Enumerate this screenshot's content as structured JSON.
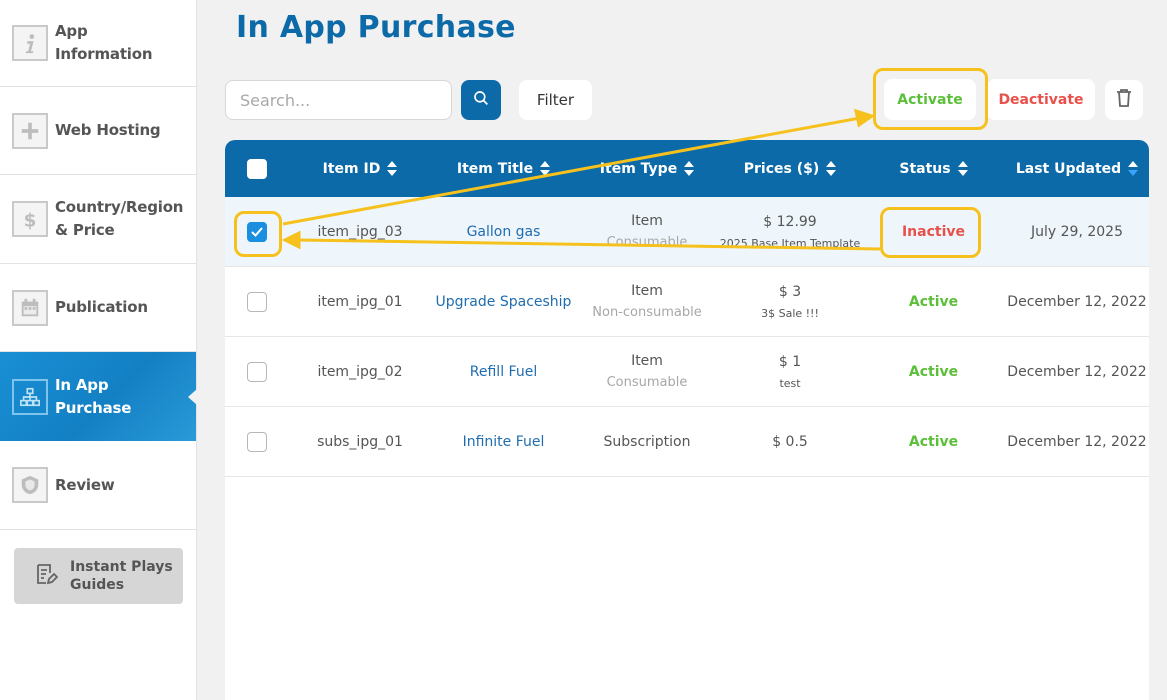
{
  "sidebar": {
    "items": [
      {
        "label": "App\nInformation",
        "icon": "info-icon"
      },
      {
        "label": "Web Hosting",
        "icon": "plus-icon"
      },
      {
        "label": "Country/Region\n& Price",
        "icon": "dollar-icon"
      },
      {
        "label": "Publication",
        "icon": "calendar-icon"
      },
      {
        "label": "In App\nPurchase",
        "icon": "hierarchy-icon",
        "active": true
      },
      {
        "label": "Review",
        "icon": "shield-icon"
      }
    ],
    "guide_label": "Instant Plays\nGuides"
  },
  "page": {
    "title": "In App Purchase"
  },
  "toolbar": {
    "search_placeholder": "Search...",
    "filter_label": "Filter",
    "activate_label": "Activate",
    "deactivate_label": "Deactivate"
  },
  "table": {
    "headers": {
      "item_id": "Item ID",
      "item_title": "Item Title",
      "item_type": "Item Type",
      "prices": "Prices ($)",
      "status": "Status",
      "last_updated": "Last Updated"
    },
    "rows": [
      {
        "checked": true,
        "id": "item_ipg_03",
        "title": "Gallon gas",
        "type": "Item",
        "type_sub": "Consumable",
        "price": "$ 12.99",
        "price_sub": "2025 Base Item Template",
        "status": "Inactive",
        "updated": "July 29, 2025"
      },
      {
        "checked": false,
        "id": "item_ipg_01",
        "title": "Upgrade Spaceship",
        "type": "Item",
        "type_sub": "Non-consumable",
        "price": "$ 3",
        "price_sub": "3$ Sale !!!",
        "status": "Active",
        "updated": "December 12, 2022"
      },
      {
        "checked": false,
        "id": "item_ipg_02",
        "title": "Refill Fuel",
        "type": "Item",
        "type_sub": "Consumable",
        "price": "$ 1",
        "price_sub": "test",
        "status": "Active",
        "updated": "December 12, 2022"
      },
      {
        "checked": false,
        "id": "subs_ipg_01",
        "title": "Infinite Fuel",
        "type": "Subscription",
        "type_sub": "",
        "price": "$ 0.5",
        "price_sub": "",
        "status": "Active",
        "updated": "December 12, 2022"
      }
    ]
  },
  "colors": {
    "brand_blue": "#0d6aa8",
    "active_green": "#5bbf3a",
    "inactive_red": "#e8504a",
    "annotation_yellow": "#f6c11d"
  }
}
